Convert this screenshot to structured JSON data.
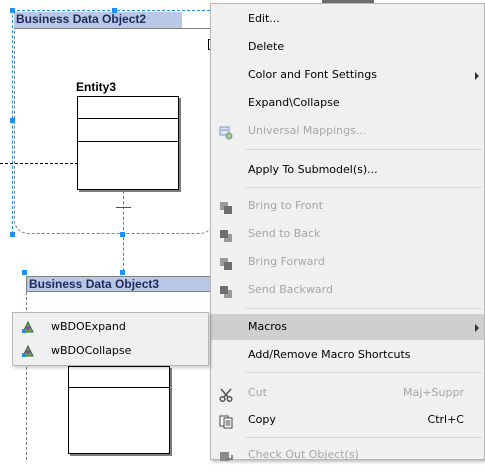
{
  "diagram": {
    "bdo1_title": "Business Data Object2",
    "bdo2_title": "Business Data Object3",
    "entity_name": "Entity3"
  },
  "context_menu": {
    "items": [
      {
        "label": "Edit...",
        "enabled": true
      },
      {
        "label": "Delete",
        "enabled": true
      },
      {
        "label": "Color and Font Settings",
        "enabled": true,
        "submenu": true
      },
      {
        "label": "Expand\\Collapse",
        "enabled": true
      },
      {
        "label": "Universal Mappings...",
        "enabled": false,
        "icon": "universal-mappings-icon"
      },
      {
        "label": "Apply To Submodel(s)...",
        "enabled": true
      },
      {
        "label": "Bring to Front",
        "enabled": false,
        "icon": "bring-to-front-icon"
      },
      {
        "label": "Send to Back",
        "enabled": false,
        "icon": "send-to-back-icon"
      },
      {
        "label": "Bring Forward",
        "enabled": false,
        "icon": "bring-forward-icon"
      },
      {
        "label": "Send Backward",
        "enabled": false,
        "icon": "send-backward-icon"
      },
      {
        "label": "Macros",
        "enabled": true,
        "submenu": true,
        "highlighted": true
      },
      {
        "label": "Add/Remove Macro Shortcuts",
        "enabled": true
      },
      {
        "label": "Cut",
        "enabled": false,
        "shortcut": "Maj+Suppr",
        "icon": "scissors-icon"
      },
      {
        "label": "Copy",
        "enabled": true,
        "shortcut": "Ctrl+C",
        "icon": "copy-icon"
      },
      {
        "label": "Check Out Object(s)",
        "enabled": false,
        "icon": "check-out-icon"
      }
    ]
  },
  "macros_submenu": {
    "items": [
      {
        "label": "wBDOExpand",
        "icon": "macro-icon"
      },
      {
        "label": "wBDOCollapse",
        "icon": "macro-icon"
      }
    ]
  },
  "colors": {
    "title_bar": "#b9c8e6",
    "selection_handle": "#1e90ff",
    "menu_background": "#f0f0f0",
    "menu_highlight": "#cfcfcf"
  }
}
